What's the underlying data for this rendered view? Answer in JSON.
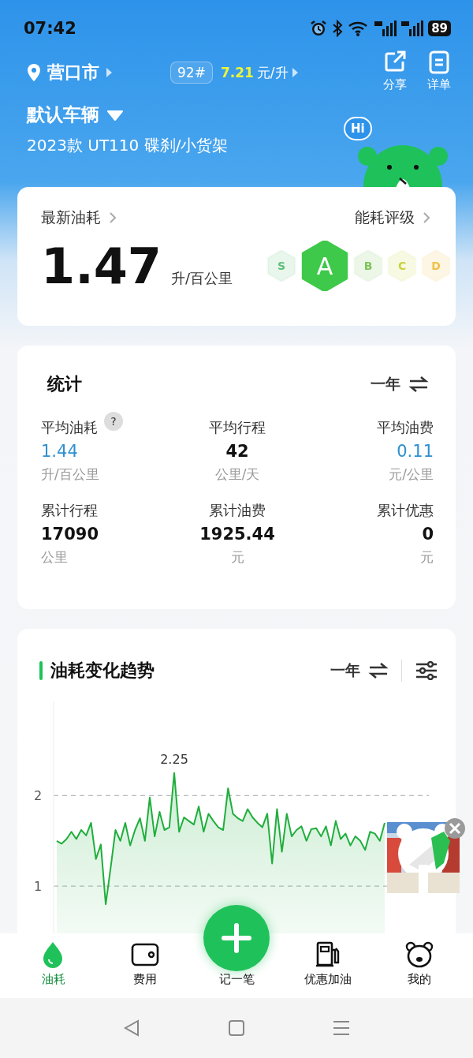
{
  "status_bar": {
    "time": "07:42",
    "battery": "89"
  },
  "header": {
    "city": "营口市",
    "fuel_grade": "92#",
    "price": "7.21",
    "price_unit": "元/升",
    "actions": [
      {
        "label": "分享",
        "kind": "share"
      },
      {
        "label": "详单",
        "kind": "list"
      }
    ]
  },
  "vehicle": {
    "name": "默认车辆",
    "model": "2023款 UT110 碟刹/小货架",
    "mascot_bubble": "Hi"
  },
  "latest": {
    "title": "最新油耗",
    "rating_title": "能耗评级",
    "value": "1.47",
    "unit": "升/百公里",
    "grades": [
      {
        "label": "S",
        "selected": false,
        "color": "#5fbf7a"
      },
      {
        "label": "A",
        "selected": true,
        "color": "#3fc94a"
      },
      {
        "label": "B",
        "selected": false,
        "color": "#7cc45a"
      },
      {
        "label": "C",
        "selected": false,
        "color": "#c8d23a"
      },
      {
        "label": "D",
        "selected": false,
        "color": "#f0c24a"
      }
    ]
  },
  "stats": {
    "title": "统计",
    "period": "一年",
    "items": [
      {
        "label": "平均油耗",
        "help": "?",
        "value": "1.44",
        "unit": "升/百公里",
        "highlight": true
      },
      {
        "label": "平均行程",
        "value": "42",
        "unit": "公里/天",
        "highlight": false
      },
      {
        "label": "平均油费",
        "value": "0.11",
        "unit": "元/公里",
        "highlight": true
      },
      {
        "label": "累计行程",
        "value": "17090",
        "unit": "公里",
        "highlight": false
      },
      {
        "label": "累计油费",
        "value": "1925.44",
        "unit": "元",
        "highlight": false
      },
      {
        "label": "累计优惠",
        "value": "0",
        "unit": "元",
        "highlight": false
      }
    ]
  },
  "trend": {
    "title": "油耗变化趋势",
    "period": "一年",
    "chart_data": {
      "type": "area",
      "yticks": [
        1,
        2
      ],
      "ylim": [
        0.34,
        3.04
      ],
      "series": [
        {
          "color": "#1fae3c",
          "values": [
            1.5,
            1.47,
            1.52,
            1.6,
            1.52,
            1.62,
            1.56,
            1.7,
            1.3,
            1.46,
            0.8,
            1.2,
            1.62,
            1.5,
            1.7,
            1.45,
            1.62,
            1.75,
            1.5,
            1.98,
            1.55,
            1.82,
            1.62,
            1.65,
            2.25,
            1.6,
            1.76,
            1.72,
            1.68,
            1.88,
            1.6,
            1.8,
            1.72,
            1.65,
            1.62,
            2.08,
            1.8,
            1.75,
            1.72,
            1.85,
            1.76,
            1.7,
            1.65,
            1.8,
            1.25,
            1.85,
            1.38,
            1.8,
            1.55,
            1.62,
            1.66,
            1.5,
            1.63,
            1.64,
            1.55,
            1.66,
            1.45,
            1.72,
            1.52,
            1.58,
            1.45,
            1.55,
            1.5,
            1.4,
            1.6,
            1.58,
            1.5,
            1.7
          ]
        }
      ],
      "annotations": [
        {
          "text": "2.25"
        }
      ]
    }
  },
  "nav": [
    {
      "label": "油耗",
      "kind": "drop",
      "selected": true
    },
    {
      "label": "费用",
      "kind": "wallet",
      "selected": false
    },
    {
      "label": "记一笔",
      "kind": "add",
      "selected": false
    },
    {
      "label": "优惠加油",
      "kind": "pump",
      "selected": false
    },
    {
      "label": "我的",
      "kind": "bear",
      "selected": false
    }
  ]
}
